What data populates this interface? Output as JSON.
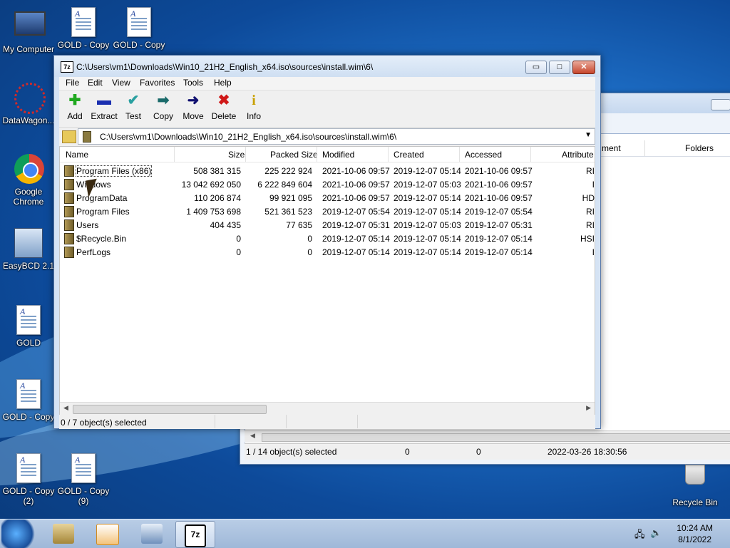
{
  "desktop": {
    "icons": [
      {
        "label": "My Computer"
      },
      {
        "label": "GOLD - Copy"
      },
      {
        "label": "GOLD - Copy"
      },
      {
        "label": "DataWagon..."
      },
      {
        "label": "Google Chrome"
      },
      {
        "label": "EasyBCD 2.1"
      },
      {
        "label": "GOLD"
      },
      {
        "label": "GOLD - Copy"
      },
      {
        "label": "GOLD - Copy (2)"
      },
      {
        "label": "GOLD - Copy (9)"
      },
      {
        "label": "Recycle Bin"
      }
    ]
  },
  "bg_window": {
    "columns": [
      "ment",
      "Folders"
    ],
    "status": {
      "selected": "1 / 14 object(s) selected",
      "size": "0",
      "packed": "0",
      "date": "2022-03-26 18:30:56"
    }
  },
  "window": {
    "app_icon": "7z",
    "title": "C:\\Users\\vm1\\Downloads\\Win10_21H2_English_x64.iso\\sources\\install.wim\\6\\",
    "menu": [
      "File",
      "Edit",
      "View",
      "Favorites",
      "Tools",
      "Help"
    ],
    "toolbar": [
      {
        "label": "Add",
        "icon": "plus-icon",
        "color": "#1fa81f"
      },
      {
        "label": "Extract",
        "icon": "minus-icon",
        "color": "#1a2fb0"
      },
      {
        "label": "Test",
        "icon": "check-icon",
        "color": "#2aa0a0"
      },
      {
        "label": "Copy",
        "icon": "double-arrow-icon",
        "color": "#1a6a6a"
      },
      {
        "label": "Move",
        "icon": "arrow-right-icon",
        "color": "#101070"
      },
      {
        "label": "Delete",
        "icon": "x-icon",
        "color": "#d01818"
      },
      {
        "label": "Info",
        "icon": "info-icon",
        "color": "#c8a000"
      }
    ],
    "address": "C:\\Users\\vm1\\Downloads\\Win10_21H2_English_x64.iso\\sources\\install.wim\\6\\",
    "columns": [
      "Name",
      "Size",
      "Packed Size",
      "Modified",
      "Created",
      "Accessed",
      "Attribute"
    ],
    "rows": [
      {
        "name": "Program Files (x86)",
        "size": "508 381 315",
        "packed": "225 222 924",
        "modified": "2021-10-06 09:57",
        "created": "2019-12-07 05:14",
        "accessed": "2021-10-06 09:57",
        "attr": "RI"
      },
      {
        "name": "Windows",
        "size": "13 042 692 050",
        "packed": "6 222 849 604",
        "modified": "2021-10-06 09:57",
        "created": "2019-12-07 05:03",
        "accessed": "2021-10-06 09:57",
        "attr": "I"
      },
      {
        "name": "ProgramData",
        "size": "110 206 874",
        "packed": "99 921 095",
        "modified": "2021-10-06 09:57",
        "created": "2019-12-07 05:14",
        "accessed": "2021-10-06 09:57",
        "attr": "HD"
      },
      {
        "name": "Program Files",
        "size": "1 409 753 698",
        "packed": "521 361 523",
        "modified": "2019-12-07 05:54",
        "created": "2019-12-07 05:14",
        "accessed": "2019-12-07 05:54",
        "attr": "RI"
      },
      {
        "name": "Users",
        "size": "404 435",
        "packed": "77 635",
        "modified": "2019-12-07 05:31",
        "created": "2019-12-07 05:03",
        "accessed": "2019-12-07 05:31",
        "attr": "RI"
      },
      {
        "name": "$Recycle.Bin",
        "size": "0",
        "packed": "0",
        "modified": "2019-12-07 05:14",
        "created": "2019-12-07 05:14",
        "accessed": "2019-12-07 05:14",
        "attr": "HSI"
      },
      {
        "name": "PerfLogs",
        "size": "0",
        "packed": "0",
        "modified": "2019-12-07 05:14",
        "created": "2019-12-07 05:14",
        "accessed": "2019-12-07 05:14",
        "attr": "I"
      }
    ],
    "status": "0 / 7 object(s) selected"
  },
  "taskbar": {
    "buttons": [
      "explorer-icon",
      "checker-icon",
      "computer-icon",
      "7zip-icon"
    ],
    "clock_time": "10:24 AM",
    "clock_date": "8/1/2022"
  }
}
